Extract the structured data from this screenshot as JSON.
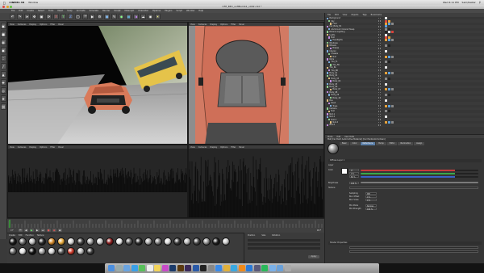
{
  "mac_menu": {
    "app_name": "CINEMA 4D",
    "items": [
      "Window"
    ],
    "clock": "Wed 4:11 PM",
    "user": "Sam/Kaster"
  },
  "window": {
    "title": "CFE_BEC_softBumb1_v002.c4d *"
  },
  "app_menu": {
    "items": [
      "File",
      "Edit",
      "Create",
      "Select",
      "Tools",
      "Mesh",
      "Snap",
      "Animate",
      "Simulate",
      "Render",
      "Sculpt",
      "MoGraph",
      "Character",
      "Pipeline",
      "Plugins",
      "Script",
      "Window",
      "Help"
    ]
  },
  "viewports": [
    {
      "name": "Perspective",
      "menu": [
        "View",
        "Cameras",
        "Display",
        "Options",
        "Filter",
        "Panel"
      ]
    },
    {
      "name": "Top",
      "menu": [
        "View",
        "Cameras",
        "Display",
        "Options",
        "Filter",
        "Panel"
      ]
    },
    {
      "name": "Right",
      "menu": [
        "View",
        "Cameras",
        "Display",
        "Options",
        "Filter",
        "Panel"
      ]
    },
    {
      "name": "Front",
      "menu": [
        "View",
        "Cameras",
        "Display",
        "Options",
        "Filter",
        "Panel"
      ]
    }
  ],
  "object_manager": {
    "menu": [
      "File",
      "Edit",
      "View",
      "Objects",
      "Tags",
      "Bookmarks"
    ],
    "rows": [
      "Background",
      "Sky",
      "Floor",
      "Car_Body_Ex",
      "Aluminium Colored Sleep",
      "Mclaren Lighting",
      "Lights",
      "Null",
      "Headlights",
      "Windows",
      "Wheels",
      "Brakes",
      "Interior",
      "Chassis",
      "Null",
      "Rims",
      "Tire_FL",
      "Tire_FR",
      "Tire_RL",
      "Tire_RR",
      "Body_01",
      "Body_02",
      "Body_03",
      "Body_04",
      "Body_05",
      "Body_06",
      "Body_07",
      "Body_08",
      "Body_09",
      "Body_10",
      "Bus",
      "Road",
      "Trees",
      "Camera",
      "Null",
      "Null.1",
      "Null.2",
      "Null.3",
      "Null.4",
      "Null.5"
    ]
  },
  "attribute_manager": {
    "menu": [
      "Mode",
      "Edit",
      "User Data"
    ],
    "material_title": "Mat [Car Paint Automotive Material] [Car PaintAutomotive1]",
    "tabs": [
      "Basic",
      "Color",
      "Reflectance",
      "Bump",
      "Editor",
      "Illumination",
      "Assign"
    ],
    "active_tab": "Reflectance",
    "section": "Diffuse Layer 1",
    "labels": {
      "layer": "Layer",
      "color": "Color",
      "brightness": "Brightness",
      "texture": "Texture",
      "sampling": "Sampling",
      "blur_offset": "Blur Offset",
      "blur_scale": "Blur Scale",
      "mix_mode": "Mix Mode",
      "mix_strength": "Mix Strength",
      "shader_props": "Shader Properties"
    },
    "values": {
      "h": "0°",
      "s": "0 %",
      "v": "80 %",
      "brightness": "100 %",
      "sampling": "MIP",
      "blur_offset": "0 %",
      "blur_scale": "0 %",
      "mix_mode": "Normal",
      "mix_strength": "100 %"
    },
    "colors": {
      "accent": "#5b7fa8",
      "red_bar": "#c83a3a",
      "green_bar": "#3aa84a",
      "blue_bar": "#3a62c8"
    }
  },
  "materials": {
    "menu": [
      "Create",
      "Edit",
      "Function",
      "Texture"
    ],
    "swatches": [
      "#1b1b1b",
      "#6e6e6e",
      "#b6b6b6",
      "#2a2a2a",
      "#d48a2a",
      "#e7a93c",
      "#cfcfcf",
      "#444444",
      "#9a9a9a",
      "#c7c7c7",
      "#8a1f1f",
      "#e6e6e6",
      "#595959",
      "#2f2f2f",
      "#a8a8a8",
      "#7d7d7d",
      "#d9d9d9",
      "#3b3b3b",
      "#b0b0b0",
      "#4c4c4c",
      "#909090",
      "#202020",
      "#c9c9c9",
      "#6a6a6a",
      "#e0e0e0",
      "#141414",
      "#9d9d9d",
      "#d0d0d0",
      "#575757",
      "#cc3b2b",
      "#b5b5b5",
      "#404040"
    ]
  },
  "coords": {
    "labels": [
      "Position",
      "Size",
      "Rotation"
    ],
    "apply_label": "Apply"
  },
  "timeline": {
    "frame_start": "0 F",
    "frame_end": "90 F"
  }
}
